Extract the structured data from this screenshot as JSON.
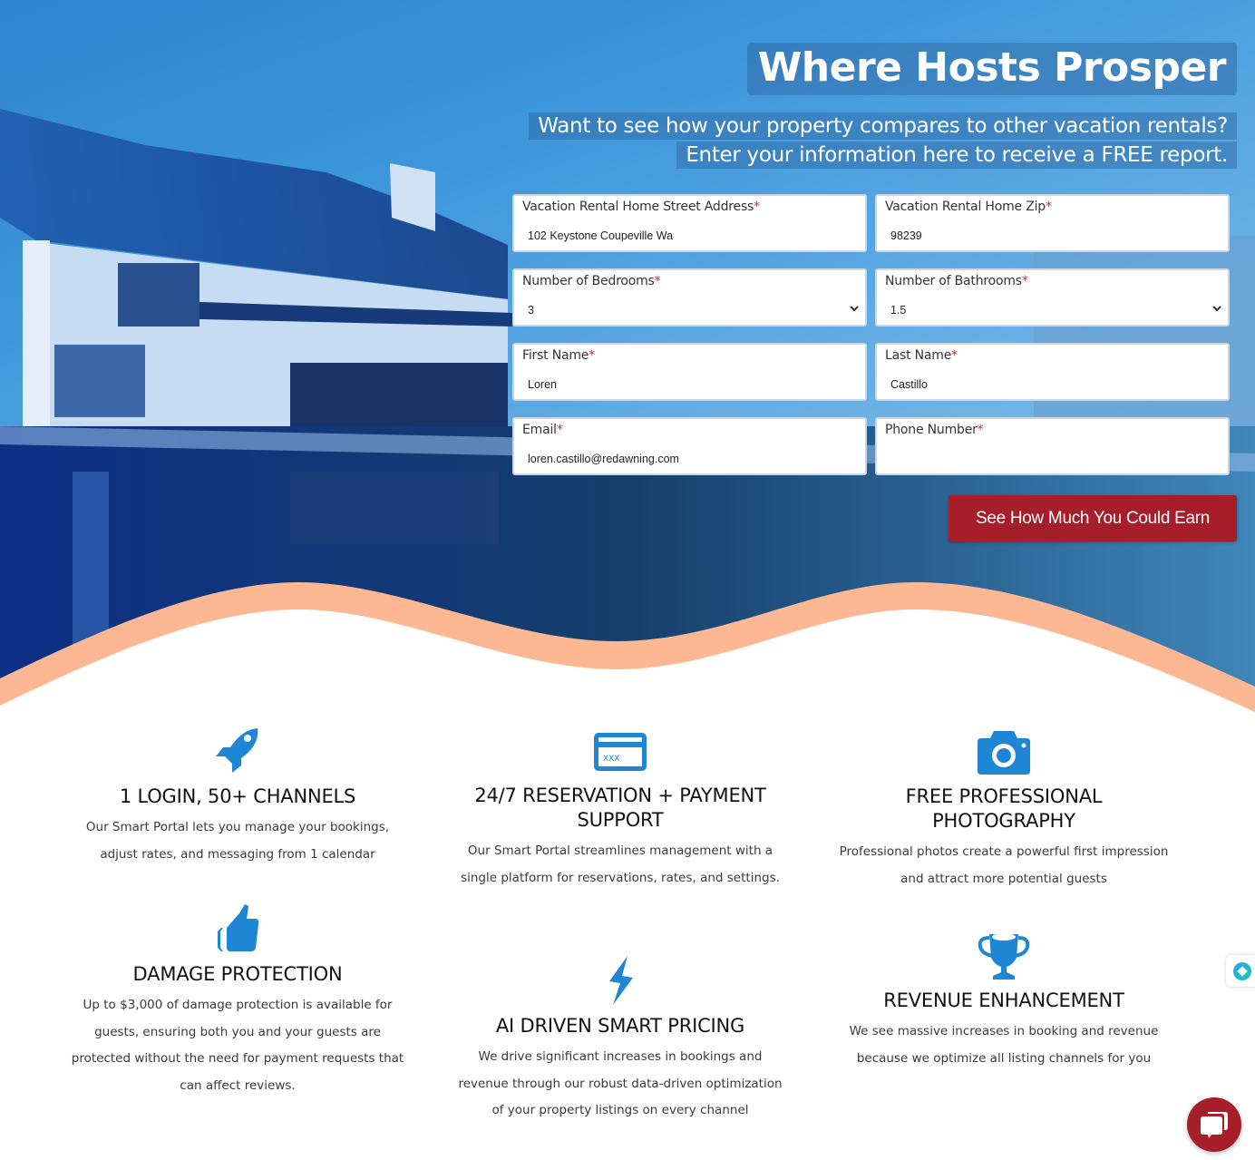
{
  "hero": {
    "headline": "Where Hosts Prosper",
    "subheadline_lines": [
      "Want to see how your property compares to other vacation rentals?",
      "Enter your information here to receive a FREE report."
    ]
  },
  "form": {
    "required_marker": "*",
    "fields": [
      {
        "label": "Vacation Rental Home Street Address",
        "type": "text",
        "value": "102 Keystone Coupeville Wa"
      },
      {
        "label": "Vacation Rental Home Zip",
        "type": "text",
        "value": "98239"
      },
      {
        "label": "Number of Bedrooms",
        "type": "select",
        "value": "3"
      },
      {
        "label": "Number of Bathrooms",
        "type": "select",
        "value": "1.5"
      },
      {
        "label": "First Name",
        "type": "text",
        "value": "Loren"
      },
      {
        "label": "Last Name",
        "type": "text",
        "value": "Castillo"
      },
      {
        "label": "Email",
        "type": "text",
        "value": "loren.castillo@redawning.com"
      },
      {
        "label": "Phone Number",
        "type": "text",
        "value": ""
      }
    ],
    "submit_label": "See How Much You Could Earn"
  },
  "features": [
    {
      "icon": "rocket-icon",
      "title": "1 LOGIN, 50+ CHANNELS",
      "text": "Our Smart Portal lets you manage your bookings, adjust rates, and messaging from 1 calendar"
    },
    {
      "icon": "credit-card-icon",
      "title": "24/7 RESERVATION + PAYMENT SUPPORT",
      "text": "Our Smart Portal streamlines management with a single platform for reservations, rates, and settings."
    },
    {
      "icon": "camera-icon",
      "title": "FREE PROFESSIONAL PHOTOGRAPHY",
      "text": "Professional photos create a powerful first impression and attract more potential guests"
    },
    {
      "icon": "thumbs-up-icon",
      "title": "DAMAGE PROTECTION",
      "text": "Up to $3,000 of damage protection is available for guests, ensuring both you and your guests are protected without the need for payment requests that can affect reviews."
    },
    {
      "icon": "lightning-bolt-icon",
      "title": "AI DRIVEN SMART PRICING",
      "text": "We drive significant increases in bookings and revenue through our robust data-driven optimization of your property listings on every channel"
    },
    {
      "icon": "trophy-icon",
      "title": "REVENUE ENHANCEMENT",
      "text": "We see massive increases in booking and revenue because we optimize all listing channels for you"
    }
  ],
  "colors": {
    "accent_blue": "#1f86d6",
    "button_red": "#a51e2a",
    "wave_peach": "#fdb893",
    "required_red": "#d12b2b"
  },
  "widgets": {
    "side_widget_icon": "assistant-orb-icon",
    "chat_icon": "chat-bubbles-icon"
  }
}
